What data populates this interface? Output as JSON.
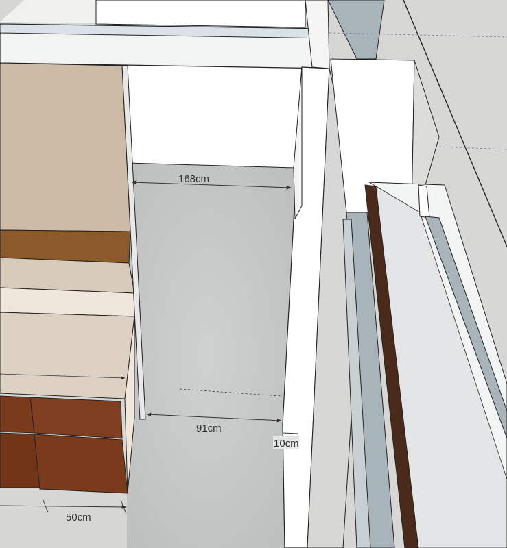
{
  "dimensions": [
    {
      "id": "top-span",
      "label": "168cm"
    },
    {
      "id": "walkway",
      "label": "91cm"
    },
    {
      "id": "wall-thickness",
      "label": "10cm"
    },
    {
      "id": "cabinet-depth",
      "label": "50cm"
    }
  ],
  "colors": {
    "floor": "#c9cbcb",
    "wall_white": "#ffffff",
    "wall_light": "#f2f3f3",
    "wall_grey": "#d7d8d6",
    "steel": "#a9b3ba",
    "wood_dark": "#7a3a1c",
    "wood_shelf": "#8a5a2a",
    "beige_panel": "#cbbba7",
    "cream": "#efe7dc",
    "outline": "#222222",
    "dimension": "#333333"
  }
}
